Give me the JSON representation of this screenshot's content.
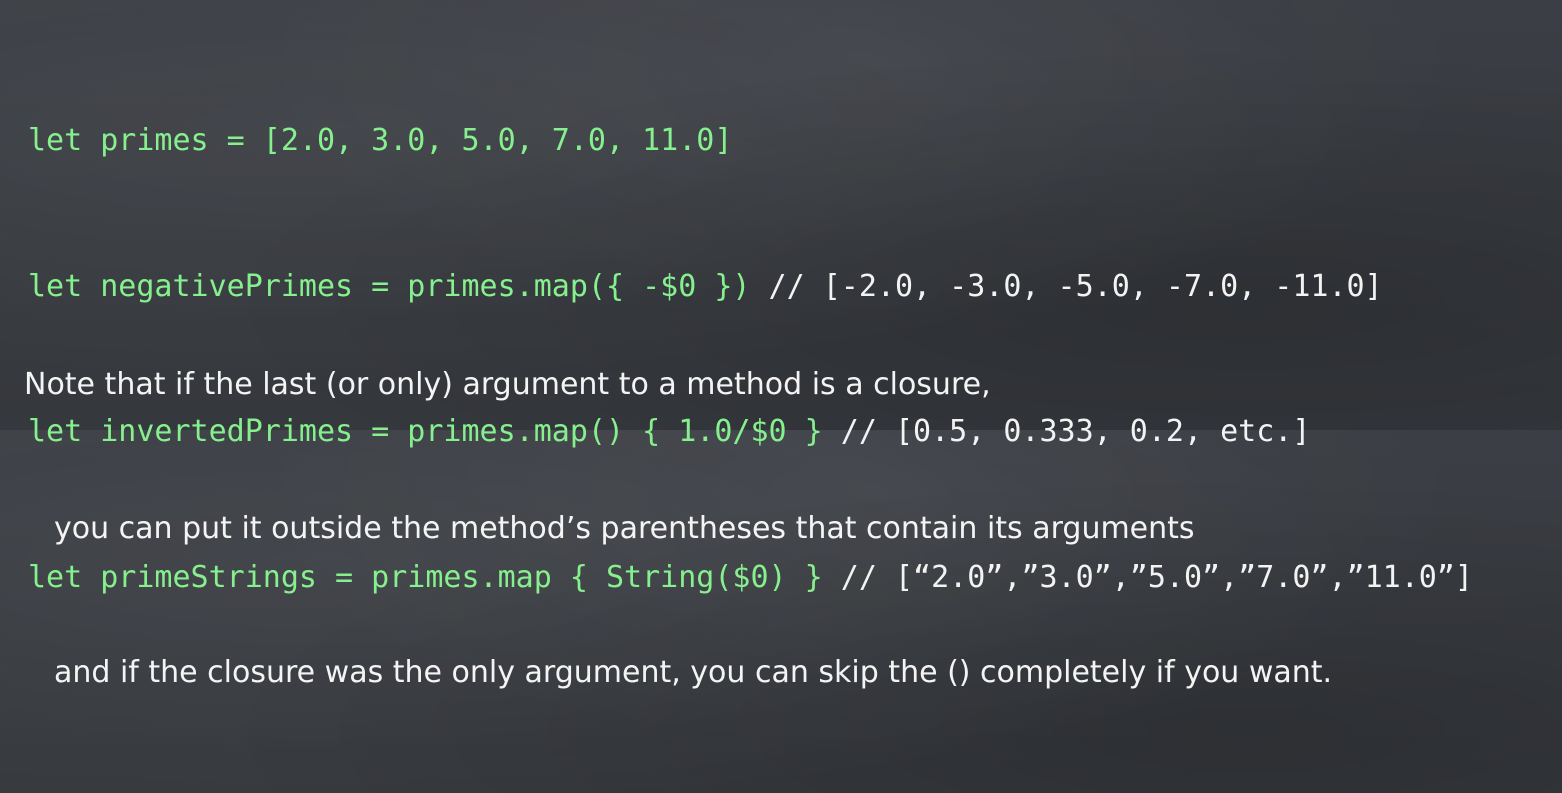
{
  "code_lines": [
    {
      "code": "let primes = [2.0, 3.0, 5.0, 7.0, 11.0]",
      "comment": ""
    },
    {
      "code": "let negativePrimes = primes.map({ -$0 }) ",
      "comment": "// [-2.0, -3.0, -5.0, -7.0, -11.0]"
    },
    {
      "code": "let invertedPrimes = primes.map() { 1.0/$0 } ",
      "comment": "// [0.5, 0.333, 0.2, etc.]"
    },
    {
      "code": "let primeStrings = primes.map { String($0) } ",
      "comment": "// [“2.0”,”3.0”,”5.0”,”7.0”,”11.0”]"
    }
  ],
  "note_lines": [
    "Note that if the last (or only) argument to a method is a closure,",
    "you can put it outside the method’s parentheses that contain its arguments",
    "and if the closure was the only argument, you can skip the () completely if you want."
  ],
  "colors": {
    "background": "#3a3d42",
    "code_green": "#86f08e",
    "text_white": "#f4f4f4"
  }
}
